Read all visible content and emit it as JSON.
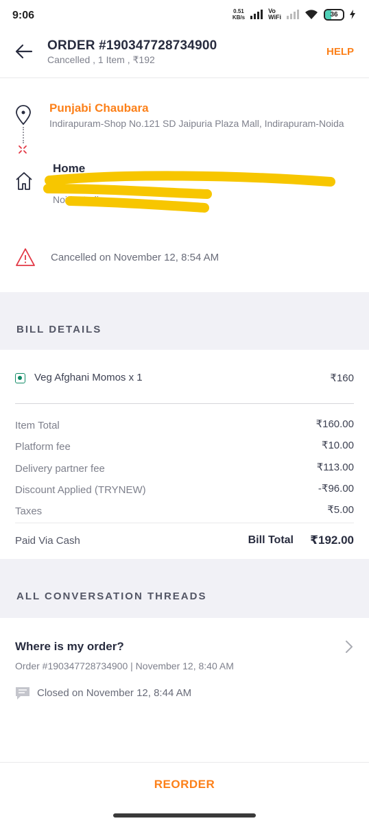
{
  "status_bar": {
    "time": "9:06",
    "net_speed_value": "0.51",
    "net_speed_unit": "KB/s",
    "vowifi_top": "Vo",
    "vowifi_bottom": "WiFi",
    "battery": "36",
    "battery_level": 0.36
  },
  "header": {
    "title": "ORDER #190347728734900",
    "subtitle": "Cancelled , 1 Item , ₹192",
    "help_label": "HELP"
  },
  "route": {
    "restaurant_name": "Punjabi Chaubara",
    "restaurant_address": "Indirapuram-Shop No.121 SD Jaipuria Plaza Mall, Indirapuram-Noida",
    "home_label": "Home",
    "home_address_line1": "",
    "home_address_line2": "Noida, India"
  },
  "status": {
    "cancel_text": "Cancelled on November 12, 8:54 AM"
  },
  "bill": {
    "section_title": "BILL DETAILS",
    "item_name": "Veg Afghani Momos x 1",
    "item_price": "₹160",
    "rows": [
      {
        "label": "Item Total",
        "value": "₹160.00"
      },
      {
        "label": "Platform fee",
        "value": "₹10.00"
      },
      {
        "label": "Delivery partner fee",
        "value": "₹113.00"
      },
      {
        "label": "Discount Applied (TRYNEW)",
        "value": "-₹96.00"
      },
      {
        "label": "Taxes",
        "value": "₹5.00"
      }
    ],
    "paid_via": "Paid Via Cash",
    "total_label": "Bill Total",
    "total_value": "₹192.00"
  },
  "conversations": {
    "section_title": "ALL CONVERSATION THREADS",
    "thread_title": "Where is my order?",
    "thread_meta": "Order #190347728734900 | November 12, 8:40 AM",
    "thread_closed": "Closed on November 12, 8:44 AM"
  },
  "footer": {
    "reorder_label": "REORDER"
  },
  "colors": {
    "accent": "#fc8019",
    "veg": "#0f8a65",
    "warning": "#e23744",
    "redaction": "#f7c600"
  },
  "icons": [
    "back-arrow-icon",
    "location-pin-icon",
    "cross-icon",
    "home-icon",
    "warning-icon",
    "veg-icon",
    "chevron-right-icon",
    "chat-icon"
  ]
}
